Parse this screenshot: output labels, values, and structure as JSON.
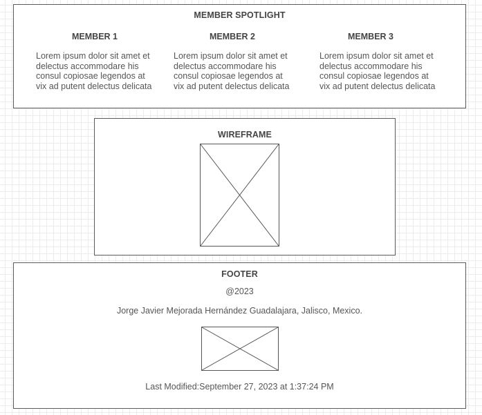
{
  "spotlight": {
    "title": "MEMBER SPOTLIGHT",
    "members": [
      {
        "name": "MEMBER 1",
        "text": "Lorem ipsum dolor sit amet et delectus accommodare his consul copiosae legendos at vix ad putent delectus delicata"
      },
      {
        "name": "MEMBER 2",
        "text": "Lorem ipsum dolor sit amet et delectus accommodare his consul copiosae legendos at vix ad putent delectus delicata"
      },
      {
        "name": "MEMBER 3",
        "text": "Lorem ipsum dolor sit amet et delectus accommodare his consul copiosae legendos at vix ad putent delectus delicata"
      }
    ]
  },
  "wireframe": {
    "title": "WIREFRAME",
    "image_icon": "image-placeholder-icon"
  },
  "footer": {
    "title": "FOOTER",
    "year": "@2023",
    "author_line": "Jorge Javier Mejorada Hernández Guadalajara, Jalisco, Mexico.",
    "image_icon": "image-placeholder-icon",
    "last_modified": "Last Modified:September 27, 2023 at 1:37:24 PM"
  },
  "colors": {
    "border": "#5a5a5a",
    "text": "#444444",
    "grid": "#ececec"
  }
}
